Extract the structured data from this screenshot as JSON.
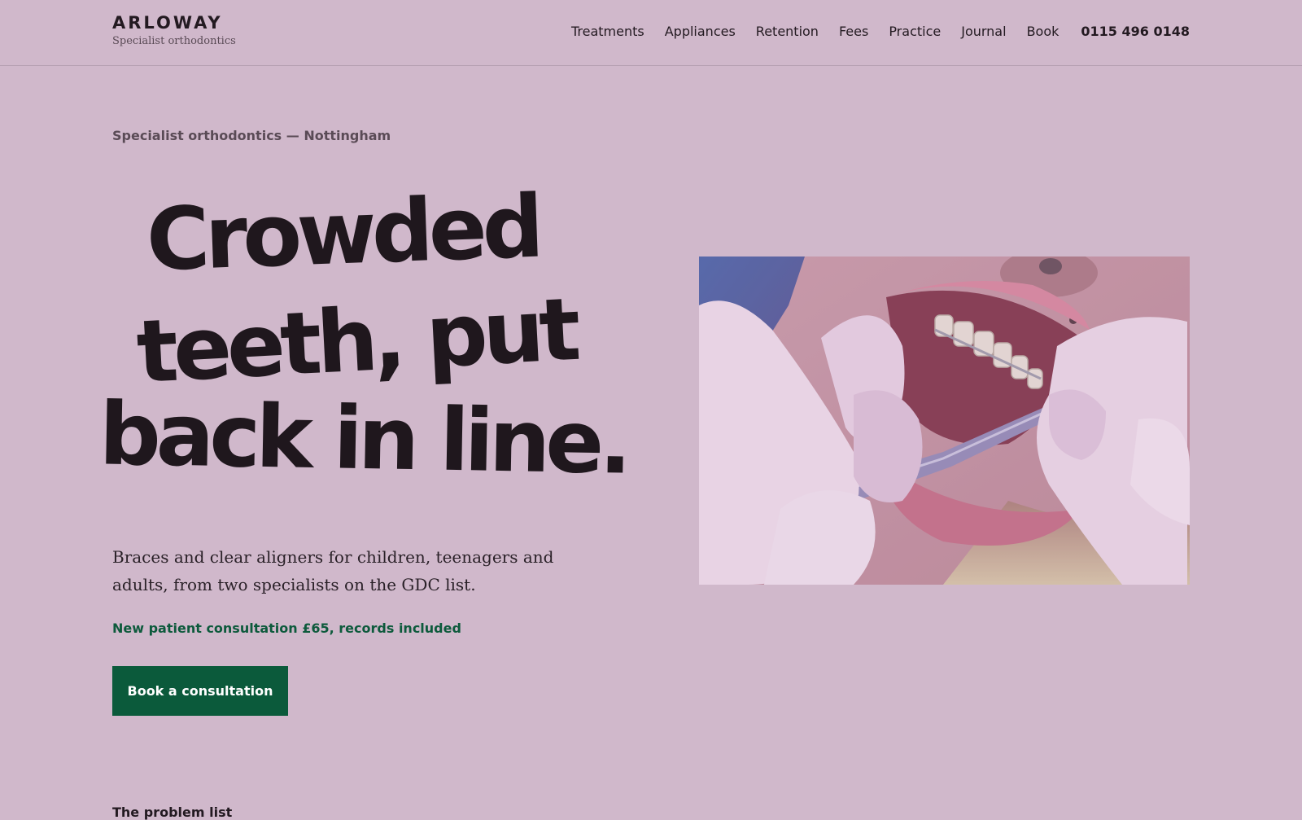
{
  "header": {
    "brand_name": "ARLOWAY",
    "brand_tagline": "Specialist orthodontics",
    "nav": [
      {
        "label": "Treatments"
      },
      {
        "label": "Appliances"
      },
      {
        "label": "Retention"
      },
      {
        "label": "Fees"
      },
      {
        "label": "Practice"
      },
      {
        "label": "Journal"
      },
      {
        "label": "Book"
      }
    ],
    "phone": "0115 496 0148"
  },
  "hero": {
    "eyebrow": "Specialist orthodontics — Nottingham",
    "headline_lines": [
      "Crowded",
      "teeth, put",
      "back in line."
    ],
    "lede": "Braces and clear aligners for children, teenagers and adults, from two specialists on the GDC list.",
    "offer": "New patient consultation £65, records included",
    "cta_label": "Book a consultation"
  },
  "next_section": {
    "heading": "The problem list"
  },
  "colors": {
    "background": "#d0b8cb",
    "text": "#1f171d",
    "accent_green": "#0b5a3b"
  }
}
